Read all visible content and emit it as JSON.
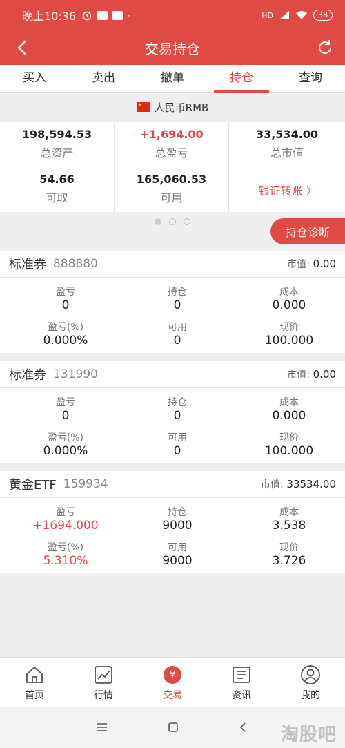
{
  "status": {
    "time": "晚上10:36",
    "battery": "38",
    "network": "HD"
  },
  "header": {
    "title": "交易持仓"
  },
  "tabs": [
    {
      "label": "买入"
    },
    {
      "label": "卖出"
    },
    {
      "label": "撤单"
    },
    {
      "label": "持仓",
      "active": true
    },
    {
      "label": "查询"
    }
  ],
  "currency": "人民币RMB",
  "summary": {
    "total_assets": {
      "value": "198,594.53",
      "label": "总资产"
    },
    "total_pnl": {
      "value": "+1,694.00",
      "label": "总盈亏"
    },
    "total_market_value": {
      "value": "33,534.00",
      "label": "总市值"
    },
    "withdrawable": {
      "value": "54.66",
      "label": "可取"
    },
    "available": {
      "value": "165,060.53",
      "label": "可用"
    },
    "transfer_label": "银证转账 〉"
  },
  "pager": {
    "count": 3,
    "current": 1
  },
  "diagnose_button": "持仓诊断",
  "field_labels": {
    "pnl": "盈亏",
    "position": "持仓",
    "cost": "成本",
    "pnl_pct": "盈亏(%)",
    "usable": "可用",
    "price": "现价",
    "market_value": "市值:"
  },
  "holdings": [
    {
      "name": "标准券",
      "code": "888880",
      "market_value": "0.00",
      "pnl": "0",
      "position": "0",
      "cost": "0.000",
      "pnl_pct": "0.000%",
      "usable": "0",
      "price": "100.000",
      "positive": false
    },
    {
      "name": "标准券",
      "code": "131990",
      "market_value": "0.00",
      "pnl": "0",
      "position": "0",
      "cost": "0.000",
      "pnl_pct": "0.000%",
      "usable": "0",
      "price": "100.000",
      "positive": false
    },
    {
      "name": "黄金ETF",
      "code": "159934",
      "market_value": "33534.00",
      "pnl": "+1694.000",
      "position": "9000",
      "cost": "3.538",
      "pnl_pct": "5.310%",
      "usable": "9000",
      "price": "3.726",
      "positive": true
    }
  ],
  "bottom_nav": [
    {
      "label": "首页",
      "icon": "home-icon"
    },
    {
      "label": "行情",
      "icon": "chart-icon"
    },
    {
      "label": "交易",
      "icon": "yuan-icon",
      "active": true
    },
    {
      "label": "资讯",
      "icon": "news-icon"
    },
    {
      "label": "我的",
      "icon": "user-icon"
    }
  ],
  "watermark": "淘股吧",
  "colors": {
    "accent": "#e04a45"
  }
}
